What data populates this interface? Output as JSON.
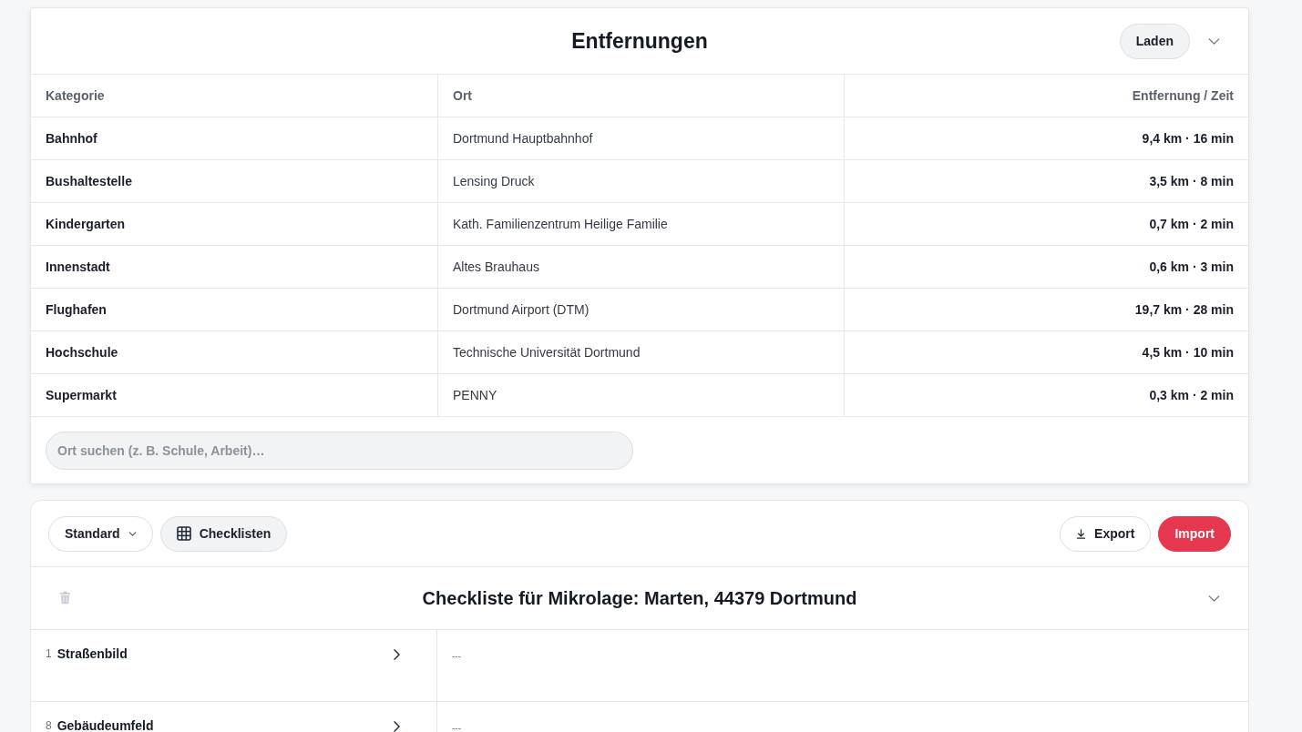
{
  "distances_panel": {
    "title": "Entfernungen",
    "load_button": "Laden",
    "table": {
      "columns": [
        "Kategorie",
        "Ort",
        "Entfernung / Zeit"
      ],
      "rows": [
        {
          "category": "Bahnhof",
          "place": "Dortmund Hauptbahnhof",
          "distance": "9,4 km · 16 min"
        },
        {
          "category": "Bushaltestelle",
          "place": "Lensing Druck",
          "distance": "3,5 km · 8 min"
        },
        {
          "category": "Kindergarten",
          "place": "Kath. Familienzentrum Heilige Familie",
          "distance": "0,7 km · 2 min"
        },
        {
          "category": "Innenstadt",
          "place": "Altes Brauhaus",
          "distance": "0,6 km · 3 min"
        },
        {
          "category": "Flughafen",
          "place": "Dortmund Airport (DTM)",
          "distance": "19,7 km · 28 min"
        },
        {
          "category": "Hochschule",
          "place": "Technische Universität Dortmund",
          "distance": "4,5 km · 10 min"
        },
        {
          "category": "Supermarkt",
          "place": "PENNY",
          "distance": "0,3 km · 2 min"
        }
      ]
    },
    "search": {
      "placeholder": "Ort suchen (z. B. Schule, Arbeit)…"
    }
  },
  "checklist_panel": {
    "toolbar": {
      "view_dropdown": "Standard",
      "checklists_button": "Checklisten",
      "export_button": "Export",
      "import_button": "Import"
    },
    "title": "Checkliste für Mikrolage: Marten, 44379 Dortmund",
    "items": [
      {
        "number": "1",
        "label": "Straßenbild",
        "value": "---"
      },
      {
        "number": "8",
        "label": "Gebäudeumfeld",
        "value": "---"
      }
    ]
  }
}
